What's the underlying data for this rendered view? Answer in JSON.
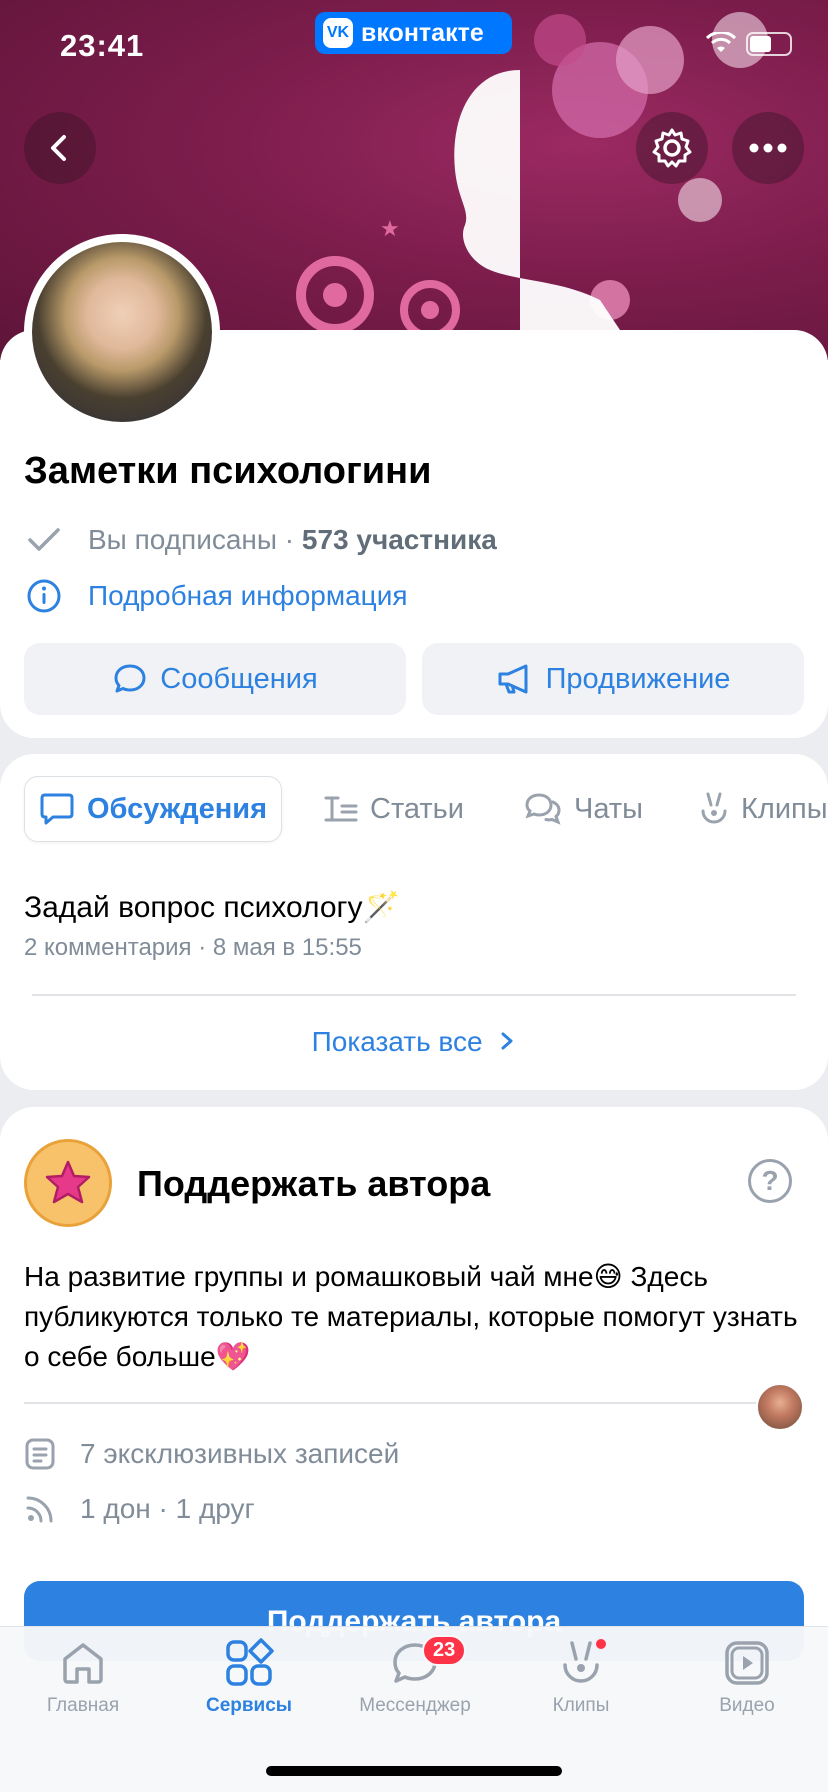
{
  "status_bar": {
    "time": "23:41",
    "app_pill": "вконтакте"
  },
  "group": {
    "name": "Заметки психологини",
    "subscribed_label": "Вы подписаны",
    "members": "573 участника",
    "details_link": "Подробная информация"
  },
  "buttons": {
    "messages": "Сообщения",
    "promotion": "Продвижение"
  },
  "tabs": [
    {
      "label": "Обсуждения",
      "active": true
    },
    {
      "label": "Статьи"
    },
    {
      "label": "Чаты"
    },
    {
      "label": "Клипы"
    }
  ],
  "discussion": {
    "title": "Задай вопрос психологу🪄",
    "meta": "2 комментария · 8 мая в 15:55",
    "show_all": "Показать все"
  },
  "support": {
    "title": "Поддержать автора",
    "description": "На развитие группы и ромашковый чай мне😅 Здесь публикуются только те материалы, которые помогут узнать о себе больше💖",
    "exclusive_posts": "7 эксклюзивных записей",
    "donations": "1 дон · 1 друг",
    "button": "Поддержать автора"
  },
  "tabbar": {
    "items": [
      {
        "label": "Главная"
      },
      {
        "label": "Сервисы",
        "active": true
      },
      {
        "label": "Мессенджер",
        "badge": "23"
      },
      {
        "label": "Клипы"
      },
      {
        "label": "Видео"
      }
    ]
  },
  "colors": {
    "accent": "#2d81e0",
    "cover": "#7c1d4c",
    "badge": "#ff3347"
  }
}
